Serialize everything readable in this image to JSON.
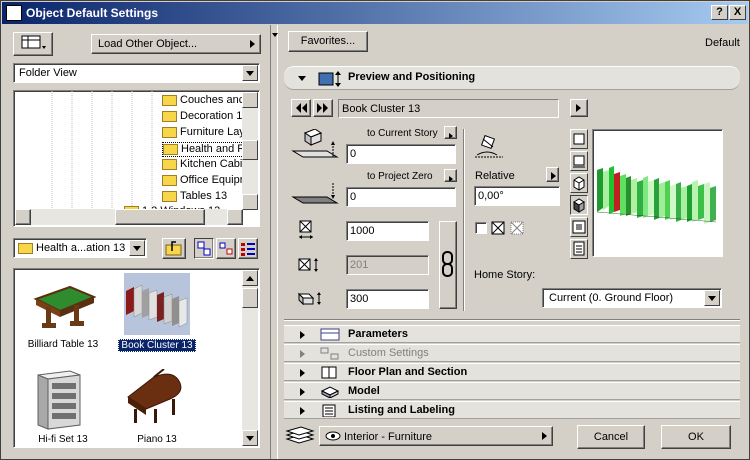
{
  "window": {
    "title": "Object Default Settings",
    "help_btn": "?",
    "close_btn": "X"
  },
  "left": {
    "load_other": "Load Other Object...",
    "view_select": "Folder View",
    "tree": [
      "Couches anc",
      "Decoration 1",
      "Furniture Lay",
      "Health and R",
      "Kitchen Cabin",
      "Office Equipr",
      "Tables 13",
      "1.2 Windows 13"
    ],
    "folder_select": "Health a...ation 13",
    "items": [
      {
        "label": "Billiard Table 13",
        "selected": false
      },
      {
        "label": "Book Cluster 13",
        "selected": true
      },
      {
        "label": "Hi-fi Set 13",
        "selected": false
      },
      {
        "label": "Piano 13",
        "selected": false
      }
    ]
  },
  "right": {
    "favorites": "Favorites...",
    "default_label": "Default",
    "preview_section": "Preview and Positioning",
    "object_name": "Book Cluster 13",
    "to_current_story": "to Current Story",
    "current_story_value": "0",
    "to_project_zero": "to Project Zero",
    "project_zero_value": "0",
    "relative": "Relative",
    "angle_value": "0,00°",
    "dim_x": "1000",
    "dim_y": "201",
    "dim_z": "300",
    "home_story_label": "Home Story:",
    "home_story_value": "Current (0. Ground Floor)",
    "sections": [
      {
        "label": "Parameters",
        "disabled": false
      },
      {
        "label": "Custom Settings",
        "disabled": true
      },
      {
        "label": "Floor Plan and Section",
        "disabled": false
      },
      {
        "label": "Model",
        "disabled": false
      },
      {
        "label": "Listing and Labeling",
        "disabled": false
      }
    ],
    "layer_value": "Interior - Furniture",
    "cancel": "Cancel",
    "ok": "OK"
  }
}
